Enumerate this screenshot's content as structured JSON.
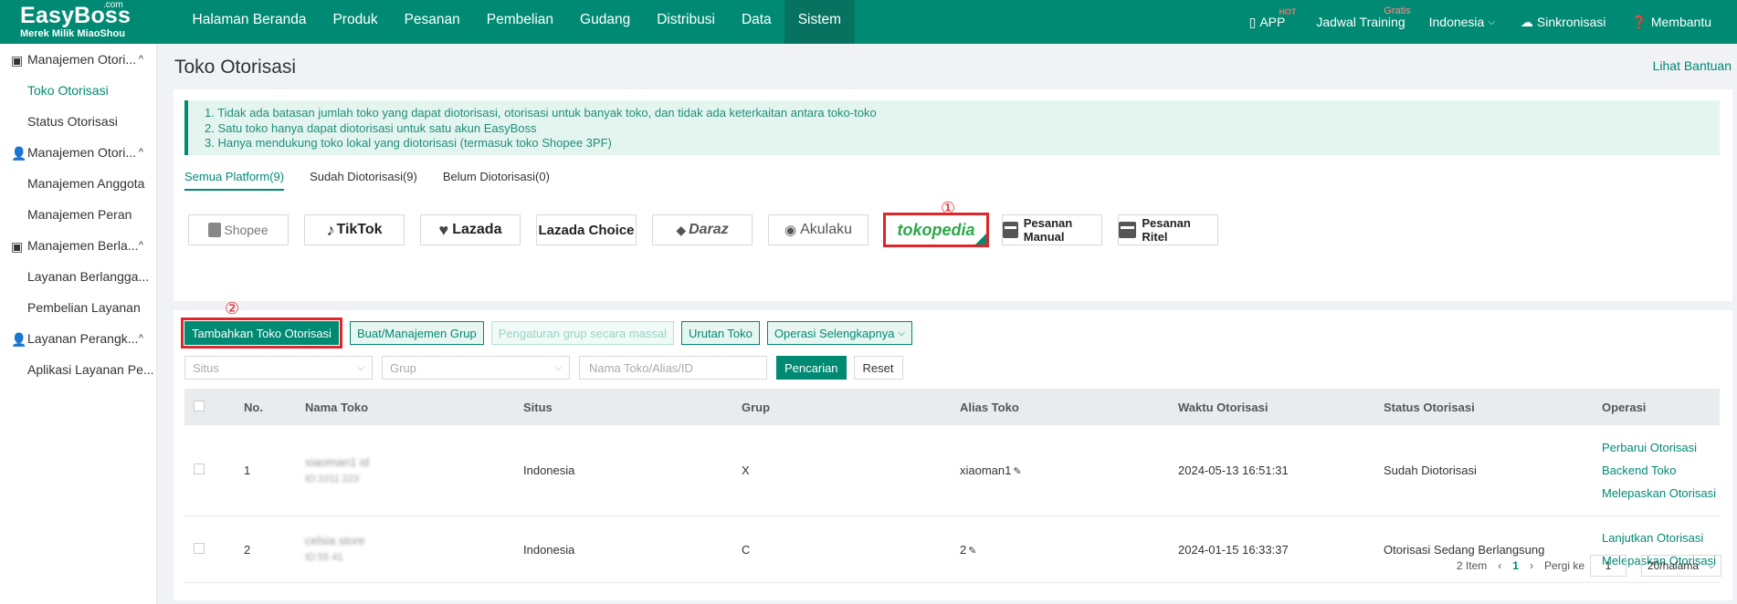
{
  "brand": {
    "name": "EasyBoss",
    "com": ".com",
    "tagline": "Merek Milik MiaoShou"
  },
  "nav": [
    "Halaman Beranda",
    "Produk",
    "Pesanan",
    "Pembelian",
    "Gudang",
    "Distribusi",
    "Data",
    "Sistem"
  ],
  "topright": {
    "app": "APP",
    "app_badge": "HOT",
    "training": "Jadwal Training",
    "training_badge": "Gratis",
    "language": "Indonesia",
    "sync": "Sinkronisasi",
    "help": "Membantu"
  },
  "sidebar": {
    "g1": "Manajemen Otori...",
    "g1_items": [
      "Toko Otorisasi",
      "Status Otorisasi"
    ],
    "g2": "Manajemen Otori...",
    "g2_items": [
      "Manajemen Anggota",
      "Manajemen Peran"
    ],
    "g3": "Manajemen Berla...",
    "g3_items": [
      "Layanan Berlangga...",
      "Pembelian Layanan"
    ],
    "g4": "Layanan Perangk...",
    "g4_items": [
      "Aplikasi Layanan Pe..."
    ]
  },
  "page": {
    "title": "Toko Otorisasi",
    "help": "Lihat Bantuan"
  },
  "notice": [
    "1. Tidak ada batasan jumlah toko yang dapat diotorisasi, otorisasi untuk banyak toko, dan tidak ada keterkaitan antara toko-toko",
    "2. Satu toko hanya dapat diotorisasi untuk satu akun EasyBoss",
    "3. Hanya mendukung toko lokal yang diotorisasi (termasuk toko Shopee 3PF)"
  ],
  "tabs": [
    "Semua Platform(9)",
    "Sudah Diotorisasi(9)",
    "Belum Diotorisasi(0)"
  ],
  "platforms": [
    "Shopee",
    "TikTok",
    "Lazada",
    "Lazada Choice",
    "Daraz",
    "Akulaku",
    "tokopedia",
    "Pesanan Manual",
    "Pesanan Ritel"
  ],
  "markers": {
    "m1": "①",
    "m2": "②"
  },
  "actions": {
    "add": "Tambahkan Toko Otorisasi",
    "group": "Buat/Manajemen Grup",
    "bulk": "Pengaturan grup secara massal",
    "sort": "Urutan Toko",
    "more": "Operasi Selengkapnya"
  },
  "filters": {
    "site": "Situs",
    "group": "Grup",
    "search_ph": "Nama Toko/Alias/ID",
    "search": "Pencarian",
    "reset": "Reset"
  },
  "table": {
    "headers": [
      "No.",
      "Nama Toko",
      "Situs",
      "Grup",
      "Alias Toko",
      "Waktu Otorisasi",
      "Status Otorisasi",
      "Operasi"
    ],
    "rows": [
      {
        "no": "1",
        "name": "xiaoman1 id",
        "id": "ID:1011 223",
        "site": "Indonesia",
        "group": "X",
        "alias": "xiaoman1",
        "time": "2024-05-13 16:51:31",
        "status": "Sudah Diotorisasi",
        "ops": [
          "Perbarui Otorisasi",
          "Backend Toko",
          "Melepaskan Otorisasi"
        ]
      },
      {
        "no": "2",
        "name": "celsia store",
        "id": "ID:55 41",
        "site": "Indonesia",
        "group": "C",
        "alias": "2",
        "time": "2024-01-15 16:33:37",
        "status": "Otorisasi Sedang Berlangsung",
        "ops": [
          "Lanjutkan Otorisasi",
          "Melepaskan Otorisasi"
        ]
      }
    ]
  },
  "pager": {
    "total": "2 Item",
    "prev": "‹",
    "current": "1",
    "next": "›",
    "goto": "Pergi ke",
    "goto_value": "1",
    "size": "20/halama"
  }
}
